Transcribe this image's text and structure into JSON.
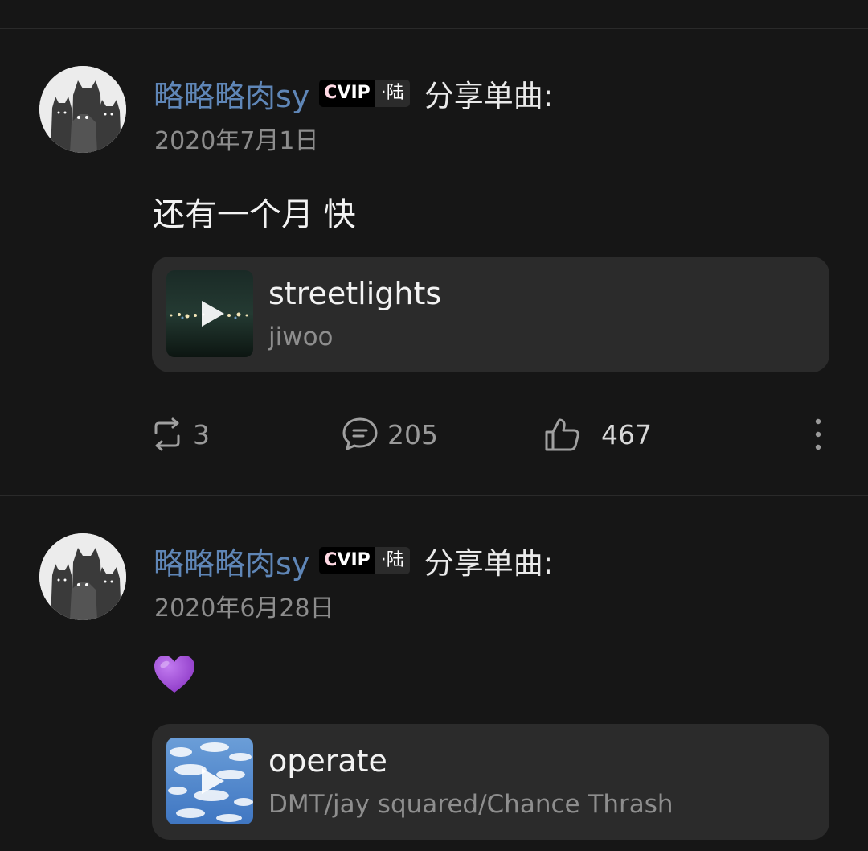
{
  "posts": [
    {
      "username": "略略略肉sy",
      "vip_badge": "VIP",
      "vip_tier": "·陆",
      "action": "分享单曲:",
      "date": "2020年7月1日",
      "text": "还有一个月 快",
      "song": {
        "title": "streetlights",
        "artist": "jiwoo"
      },
      "stats": {
        "reposts": "3",
        "comments": "205",
        "likes": "467"
      }
    },
    {
      "username": "略略略肉sy",
      "vip_badge": "VIP",
      "vip_tier": "·陆",
      "action": "分享单曲:",
      "date": "2020年6月28日",
      "text_emoji": "purple-heart",
      "song": {
        "title": "operate",
        "artist": "DMT/jay squared/Chance Thrash"
      }
    }
  ],
  "colors": {
    "background": "#161616",
    "username": "#5f86b7",
    "card": "#2b2b2b",
    "heart": "#9b4bd0"
  },
  "icons": [
    "repost-icon",
    "comment-icon",
    "like-icon",
    "more-vertical-icon",
    "play-icon",
    "purple-heart-emoji"
  ]
}
